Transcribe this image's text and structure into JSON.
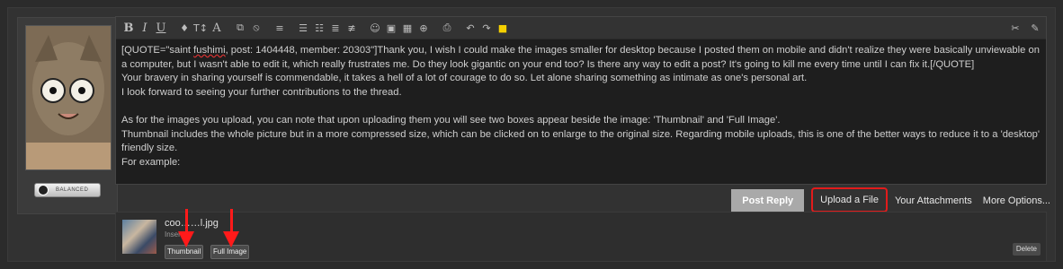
{
  "editor": {
    "toolbar_left": [
      "B",
      "I",
      "U",
      "♦",
      "T↕",
      "A",
      "⧉",
      "⦸",
      "≡",
      "☰",
      "☷",
      "≣",
      "≢",
      "☺",
      "▣",
      "▦",
      "⊕",
      "⎙",
      "↶",
      "↷",
      "■"
    ],
    "toolbar_right": [
      "✂",
      "✎"
    ],
    "quote_line_before": "[QUOTE=\"saint ",
    "quote_spell": "fushimi",
    "quote_line_after": ", post: 1404448, member: 20303\"]Thank you, I wish I could make the images smaller for desktop because I posted them on mobile and didn't realize they were basically unviewable on a computer, but I wasn't able to edit it, which really frustrates me. Do they look gigantic on your end too? Is there any way to edit a post? It's going to kill me every time until I can fix it.[/QUOTE]",
    "body": "Your bravery in sharing yourself is commendable, it takes a hell of a lot of courage to do so. Let alone sharing something as intimate as one's personal art.\nI look forward to seeing your further contributions to the thread.\n\nAs for the images you upload, you can note that upon uploading them you will see two boxes appear beside the image: 'Thumbnail' and 'Full Image'.\nThumbnail includes the whole picture but in a more compressed size, which can be clicked on to enlarge to the original size. Regarding mobile uploads, this is one of the better ways to reduce it to a 'desktop' friendly size.\nFor example:"
  },
  "buttons": {
    "post_reply": "Post Reply",
    "upload_file": "Upload a File",
    "attachments": "Your Attachments",
    "more_options": "More Options..."
  },
  "attachment": {
    "filename": "coo……l.jpg",
    "insert": "Insert:",
    "thumbnail": "Thumbnail",
    "full_image": "Full Image",
    "delete": "Delete"
  },
  "colors": {
    "highlight": "#e21b1b",
    "arrow": "#ff1a1a"
  }
}
